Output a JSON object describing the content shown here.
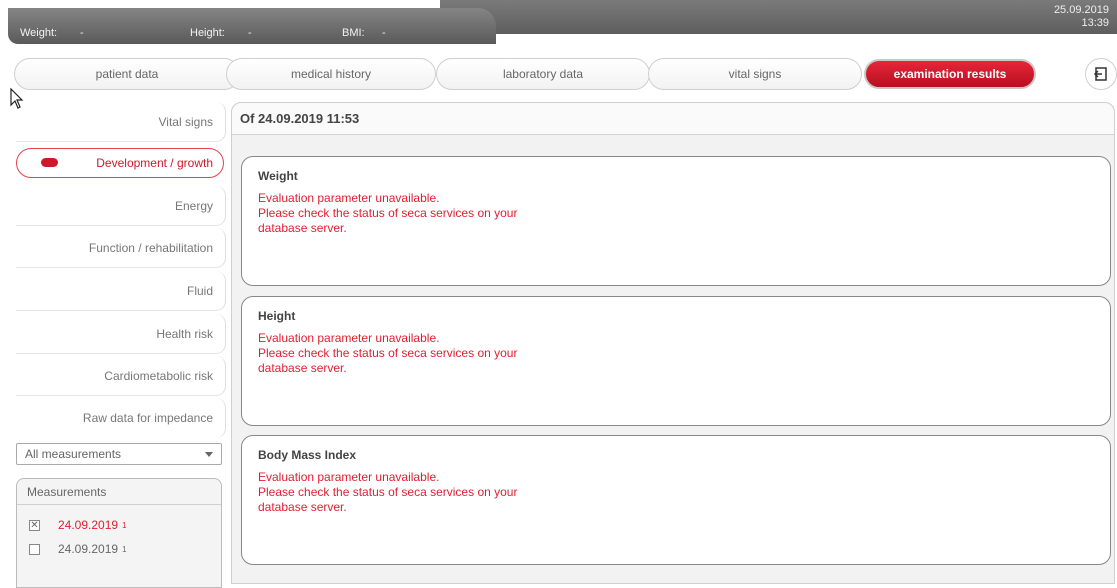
{
  "header": {
    "weight_label": "Weight:",
    "weight_value": "-",
    "height_label": "Height:",
    "height_value": "-",
    "bmi_label": "BMI:",
    "bmi_value": "-",
    "date": "25.09.2019",
    "time": "13:39"
  },
  "tabs": [
    {
      "label": "patient data"
    },
    {
      "label": "medical history"
    },
    {
      "label": "laboratory data"
    },
    {
      "label": "vital signs"
    },
    {
      "label": "examination results",
      "active": true
    }
  ],
  "sidebar": {
    "items": [
      {
        "label": "Vital signs"
      },
      {
        "label": "Development / growth",
        "active": true
      },
      {
        "label": "Energy"
      },
      {
        "label": "Function / rehabilitation"
      },
      {
        "label": "Fluid"
      },
      {
        "label": "Health risk"
      },
      {
        "label": "Cardiometabolic risk"
      },
      {
        "label": "Raw data for impedance"
      }
    ],
    "filter_select": {
      "value": "All measurements"
    },
    "measurements": {
      "title": "Measurements",
      "rows": [
        {
          "date": "24.09.2019",
          "sup": "1",
          "checked": true
        },
        {
          "date": "24.09.2019",
          "sup": "1",
          "checked": false
        }
      ]
    }
  },
  "content": {
    "title": "Of 24.09.2019 11:53",
    "cards": [
      {
        "title": "Weight",
        "lines": [
          "Evaluation parameter unavailable.",
          "Please check the status of seca services on your",
          "database server."
        ]
      },
      {
        "title": "Height",
        "lines": [
          "Evaluation parameter unavailable.",
          "Please check the status of seca services on your",
          "database server."
        ]
      },
      {
        "title": "Body Mass Index",
        "lines": [
          "Evaluation parameter unavailable.",
          "Please check the status of seca services on your",
          "database server."
        ]
      }
    ]
  },
  "colors": {
    "accent": "#d0182b",
    "error_text": "#e01f32",
    "header_bg": "#6a6a6a"
  },
  "icons": {
    "logout": "logout-icon",
    "cursor": "mouse-pointer-icon",
    "checkbox_checked": "x-checkbox-icon"
  }
}
